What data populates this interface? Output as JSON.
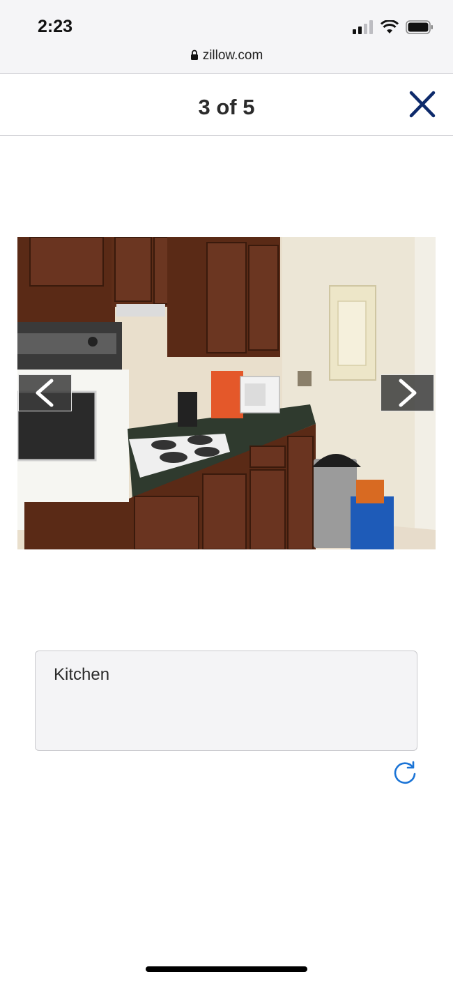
{
  "status_bar": {
    "time": "2:23",
    "url": "zillow.com",
    "icons": [
      "signal-icon",
      "wifi-icon",
      "battery-icon"
    ]
  },
  "viewer": {
    "counter": "3 of 5",
    "close_icon": "close-icon"
  },
  "photo": {
    "alt": "Kitchen photo with wood cabinets, wall oven, cooktop and microwave",
    "prev_icon": "chevron-left-icon",
    "next_icon": "chevron-right-icon"
  },
  "caption": {
    "text": "Kitchen",
    "refresh_icon": "refresh-icon"
  },
  "colors": {
    "accent": "#0d2a6b",
    "link_blue": "#1b74d6",
    "caption_bg": "#f4f4f6"
  }
}
